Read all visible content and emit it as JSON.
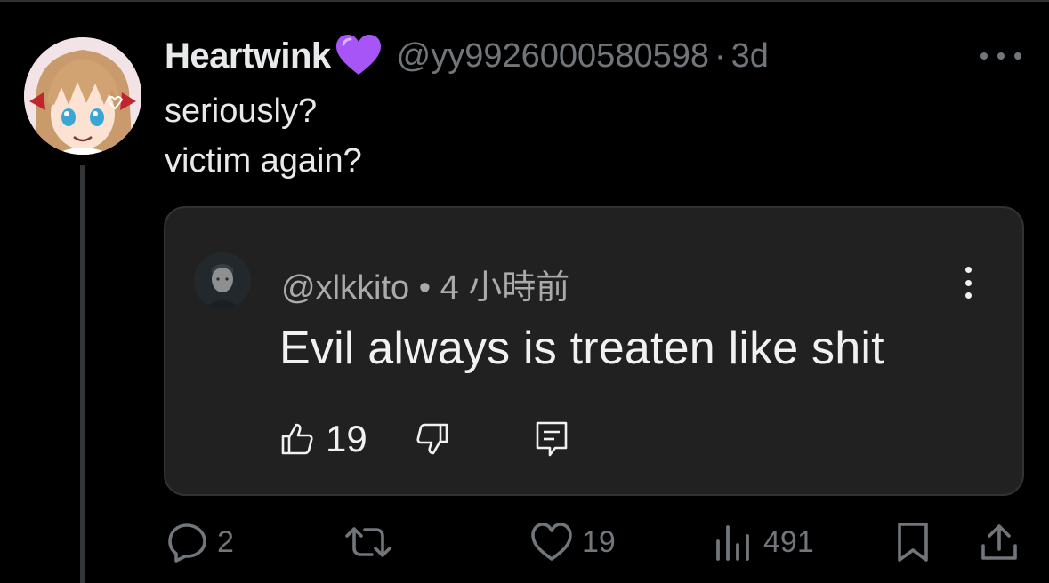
{
  "tweet": {
    "display_name": "Heartwink",
    "name_emoji": "purple-heart",
    "handle": "@yy9926000580598",
    "separator": "·",
    "time": "3d",
    "text_lines": [
      "seriously?",
      "victim again?"
    ]
  },
  "embedded_comment": {
    "handle": "@xlkkito",
    "separator": "•",
    "time": "4 小時前",
    "text": "Evil always is treaten like shit",
    "like_count": "19"
  },
  "actions": {
    "replies": "2",
    "reposts": "",
    "likes": "19",
    "views": "491"
  },
  "colors": {
    "background": "#000000",
    "primary_text": "#e7e9ea",
    "secondary_text": "#71767b",
    "card_background": "#212121",
    "heart_emoji": "#a855f7"
  }
}
